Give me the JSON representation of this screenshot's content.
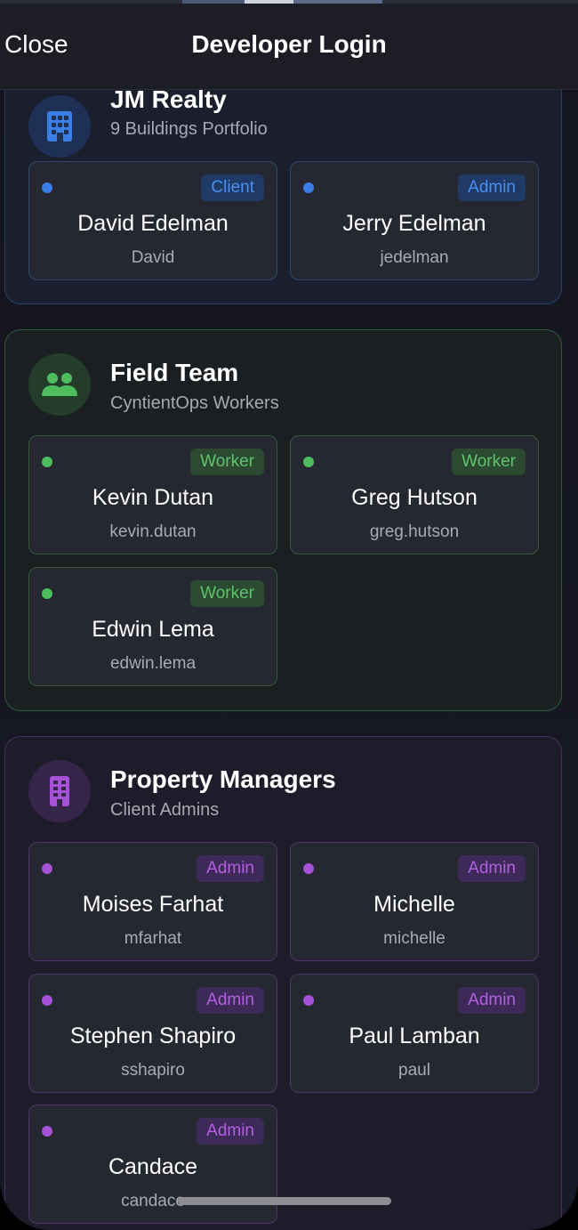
{
  "nav": {
    "close_label": "Close",
    "title": "Developer Login"
  },
  "colors": {
    "blue_accent": "#3a7ee8",
    "green_accent": "#4ebd5d",
    "purple_accent": "#a652d6"
  },
  "sections": [
    {
      "title": "JM Realty",
      "subtitle": "9 Buildings Portfolio",
      "icon": "building-icon",
      "accounts": [
        {
          "name": "David Edelman",
          "username": "David",
          "role": "Client"
        },
        {
          "name": "Jerry Edelman",
          "username": "jedelman",
          "role": "Admin"
        }
      ]
    },
    {
      "title": "Field Team",
      "subtitle": "CyntientOps Workers",
      "icon": "people-icon",
      "accounts": [
        {
          "name": "Kevin Dutan",
          "username": "kevin.dutan",
          "role": "Worker"
        },
        {
          "name": "Greg Hutson",
          "username": "greg.hutson",
          "role": "Worker"
        },
        {
          "name": "Edwin Lema",
          "username": "edwin.lema",
          "role": "Worker"
        }
      ]
    },
    {
      "title": "Property Managers",
      "subtitle": "Client Admins",
      "icon": "apartment-building-icon",
      "accounts": [
        {
          "name": "Moises Farhat",
          "username": "mfarhat",
          "role": "Admin"
        },
        {
          "name": "Michelle",
          "username": "michelle",
          "role": "Admin"
        },
        {
          "name": "Stephen Shapiro",
          "username": "sshapiro",
          "role": "Admin"
        },
        {
          "name": "Paul Lamban",
          "username": "paul",
          "role": "Admin"
        },
        {
          "name": "Candace",
          "username": "candace",
          "role": "Admin"
        }
      ]
    }
  ]
}
